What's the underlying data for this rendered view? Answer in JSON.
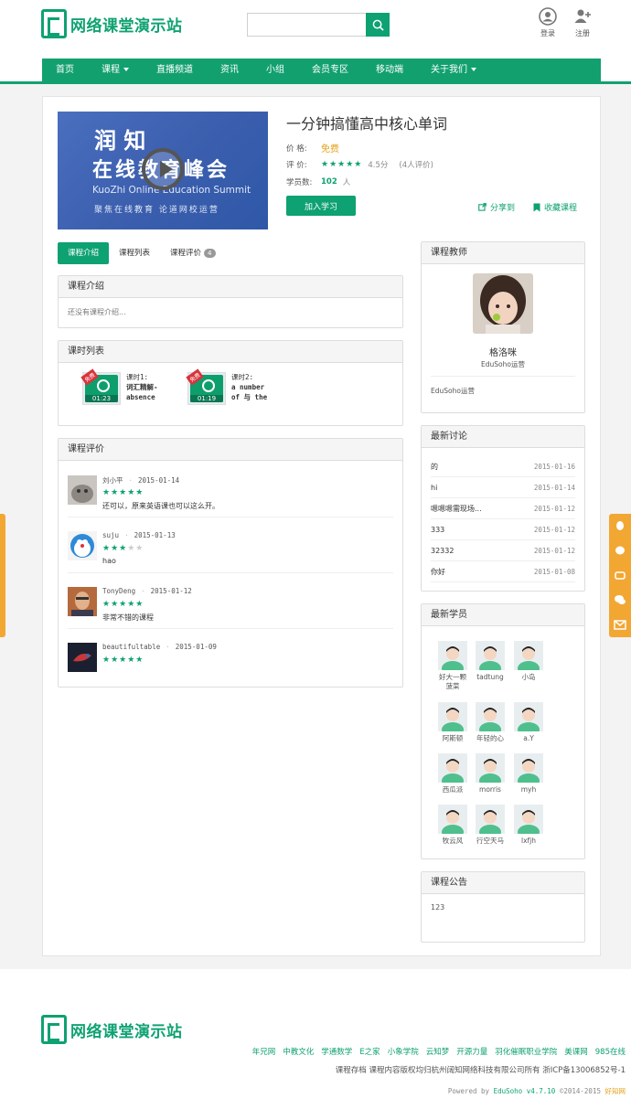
{
  "site": {
    "name": "网络课堂演示站"
  },
  "header": {
    "search_placeholder": "",
    "login": "登录",
    "register": "注册"
  },
  "nav": {
    "items": [
      "首页",
      "课程",
      "直播频道",
      "资讯",
      "小组",
      "会员专区",
      "移动端",
      "关于我们"
    ],
    "with_caret": [
      false,
      true,
      false,
      false,
      false,
      false,
      false,
      true
    ]
  },
  "course": {
    "banner": {
      "line1": "润 知",
      "line2": "在线教育峰会",
      "en": "KuoZhi Online Education Summit",
      "sub": "聚焦在线教育    论道网校运营"
    },
    "title": "一分钟搞懂高中核心单词",
    "price_label": "价    格:",
    "price": "免费",
    "rating_label": "评    价:",
    "rating_stars": "★★★★★",
    "rating_score": "4.5分",
    "rating_count": "(4人评价)",
    "students_label": "学员数:",
    "students": "102",
    "students_unit": "人",
    "learn_button": "加入学习",
    "share": "分享到",
    "favorite": "收藏课程"
  },
  "tabs": [
    {
      "label": "课程介绍",
      "active": true
    },
    {
      "label": "课程列表",
      "active": false
    },
    {
      "label": "课程评价",
      "active": false,
      "badge": "4"
    }
  ],
  "intro": {
    "title": "课程介绍",
    "text": "还没有课程介绍..."
  },
  "lessons": {
    "title": "课时列表",
    "items": [
      {
        "ribbon": "免费",
        "duration": "01:23",
        "num": "课时1:",
        "name1": "词汇精解-",
        "name2": "absence"
      },
      {
        "ribbon": "免费",
        "duration": "01:19",
        "num": "课时2:",
        "name1": "a number",
        "name2": "of 与 the"
      }
    ]
  },
  "reviews": {
    "title": "课程评价",
    "items": [
      {
        "user": "刘小平",
        "date": "2015-01-14",
        "stars": "★★★★★",
        "stars_off": "",
        "text": "还可以，原来英语课也可以这么开。"
      },
      {
        "user": "suju",
        "date": "2015-01-13",
        "stars": "★★★",
        "stars_off": "★★",
        "text": "hao"
      },
      {
        "user": "TonyDeng",
        "date": "2015-01-12",
        "stars": "★★★★★",
        "stars_off": "",
        "text": "非常不错的课程"
      },
      {
        "user": "beautifultable",
        "date": "2015-01-09",
        "stars": "★★★★★",
        "stars_off": "",
        "text": ""
      }
    ]
  },
  "teacher": {
    "title": "课程教师",
    "name": "格洛咪",
    "role": "EduSoho运营",
    "bio": "EduSoho运营"
  },
  "discussions": {
    "title": "最新讨论",
    "items": [
      {
        "title": "的",
        "date": "2015-01-16"
      },
      {
        "title": "hi",
        "date": "2015-01-14"
      },
      {
        "title": "嗯嗯嗯需现场...",
        "date": "2015-01-12"
      },
      {
        "title": "333",
        "date": "2015-01-12"
      },
      {
        "title": "32332",
        "date": "2015-01-12"
      },
      {
        "title": "你好",
        "date": "2015-01-08"
      }
    ]
  },
  "students": {
    "title": "最新学员",
    "items": [
      {
        "name": "好大一颗",
        "name2": "菠菜"
      },
      {
        "name": "tadtung",
        "name2": ""
      },
      {
        "name": "小岛",
        "name2": ""
      },
      {
        "name": "阿斯顿",
        "name2": ""
      },
      {
        "name": "年轻的心",
        "name2": ""
      },
      {
        "name": "a.Y",
        "name2": ""
      },
      {
        "name": "西瓜派",
        "name2": ""
      },
      {
        "name": "morris",
        "name2": ""
      },
      {
        "name": "myh",
        "name2": ""
      },
      {
        "name": "牧云风",
        "name2": ""
      },
      {
        "name": "行空天马",
        "name2": ""
      },
      {
        "name": "lxfjh",
        "name2": ""
      }
    ]
  },
  "notice": {
    "title": "课程公告",
    "text": "123"
  },
  "footer": {
    "links": [
      "年兄网",
      "中教文化",
      "学通数学",
      "E之家",
      "小象学院",
      "云知梦",
      "开源力量",
      "羽化催眠职业学院",
      "美课网",
      "985在线"
    ],
    "copy": "课程存档 课程内容版权均归杭州阔知网络科技有限公司所有     浙ICP备13006852号-1",
    "powered_prefix": "Powered by",
    "powered_name": "EduSoho v4.7.10",
    "powered_year": "©2014-2015",
    "powered_org": "好知网"
  },
  "colors": {
    "brand": "#0ea172",
    "accent": "#e4a118",
    "tool": "#f2a733"
  }
}
